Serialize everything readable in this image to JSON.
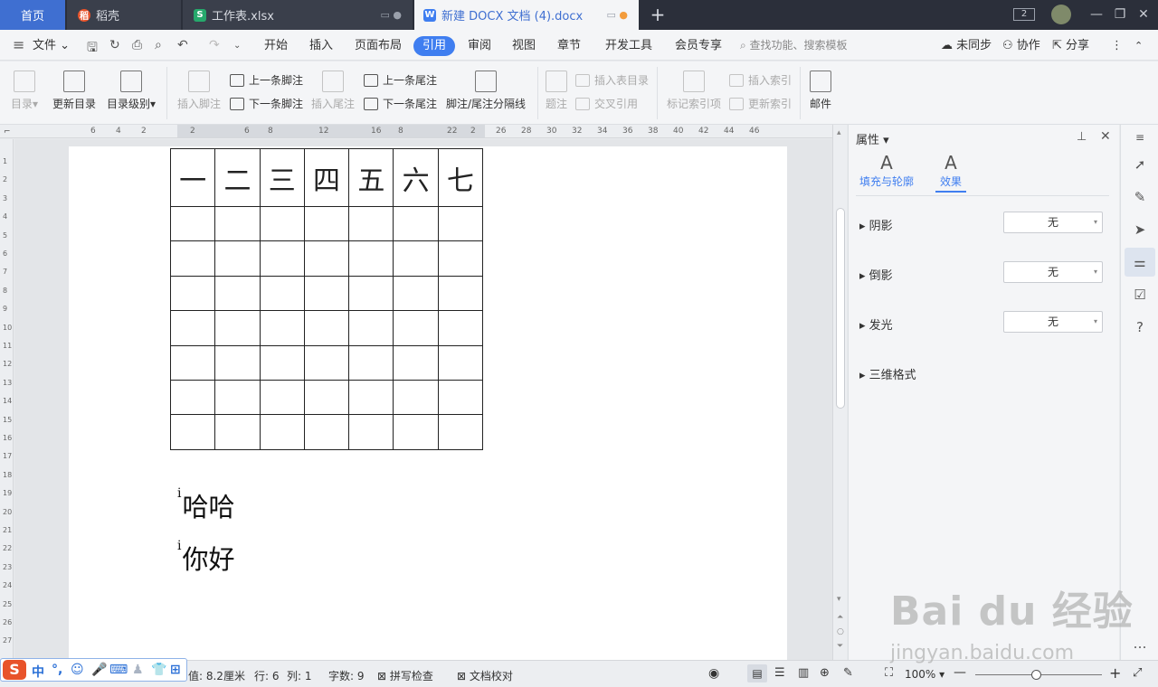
{
  "tabs": {
    "home": "首页",
    "daoke": "稻壳",
    "xlsx": "工作表.xlsx",
    "docx": "新建 DOCX 文档 (4).docx",
    "window_badge": "2"
  },
  "menu": {
    "file": "文件",
    "items": [
      "开始",
      "插入",
      "页面布局",
      "引用",
      "审阅",
      "视图",
      "章节",
      "开发工具",
      "会员专享"
    ],
    "search_placeholder": "查找功能、搜索模板",
    "sync": "未同步",
    "collab": "协作",
    "share": "分享"
  },
  "ribbon": {
    "toc": "目录",
    "update_toc": "更新目录",
    "toc_level": "目录级别",
    "insert_footnote": "插入脚注",
    "prev_footnote": "上一条脚注",
    "next_footnote": "下一条脚注",
    "insert_endnote": "插入尾注",
    "prev_endnote": "上一条尾注",
    "next_endnote": "下一条尾注",
    "separator": "脚注/尾注分隔线",
    "caption": "题注",
    "insert_table_toc": "插入表目录",
    "cross_ref": "交叉引用",
    "mark_index": "标记索引项",
    "insert_index": "插入索引",
    "update_index": "更新索引",
    "mail": "邮件"
  },
  "ruler": {
    "h_ticks": [
      "6",
      "4",
      "2",
      "2",
      "6",
      "8",
      "12",
      "16",
      "8",
      "22",
      "2",
      "26",
      "28",
      "30",
      "32",
      "34",
      "36",
      "38",
      "40",
      "42",
      "44",
      "46"
    ],
    "v_ticks": [
      "1",
      "2",
      "3",
      "4",
      "5",
      "6",
      "7",
      "8",
      "9",
      "10",
      "11",
      "12",
      "13",
      "14",
      "15",
      "16",
      "17",
      "18",
      "19",
      "20",
      "21",
      "22",
      "23",
      "24",
      "25",
      "26",
      "27"
    ]
  },
  "document": {
    "header_row": [
      "一",
      "二",
      "三",
      "四",
      "五",
      "六",
      "七"
    ],
    "empty_rows": 7,
    "para1": "哈哈",
    "para2": "你好",
    "para_mark": "i"
  },
  "panel": {
    "title": "属性",
    "tab_fill": "填充与轮廓",
    "tab_effect": "效果",
    "shadow": "阴影",
    "reflection": "倒影",
    "glow": "发光",
    "three_d": "三维格式",
    "shadow_value": "无",
    "reflection_value": "无",
    "glow_value": "无"
  },
  "status": {
    "position": "值: 8.2厘米",
    "row": "行: 6",
    "col": "列: 1",
    "words": "字数: 9",
    "spell": "拼写检查",
    "proof": "文档校对",
    "zoom": "100%"
  },
  "ime": {
    "mode": "中"
  },
  "watermark": {
    "brand": "Bai du 经验",
    "url": "jingyan.baidu.com"
  },
  "colors": {
    "accent": "#3f7ef0",
    "tabbar": "#2b2f3a",
    "doc_tab_dot": "#f39c3c"
  }
}
